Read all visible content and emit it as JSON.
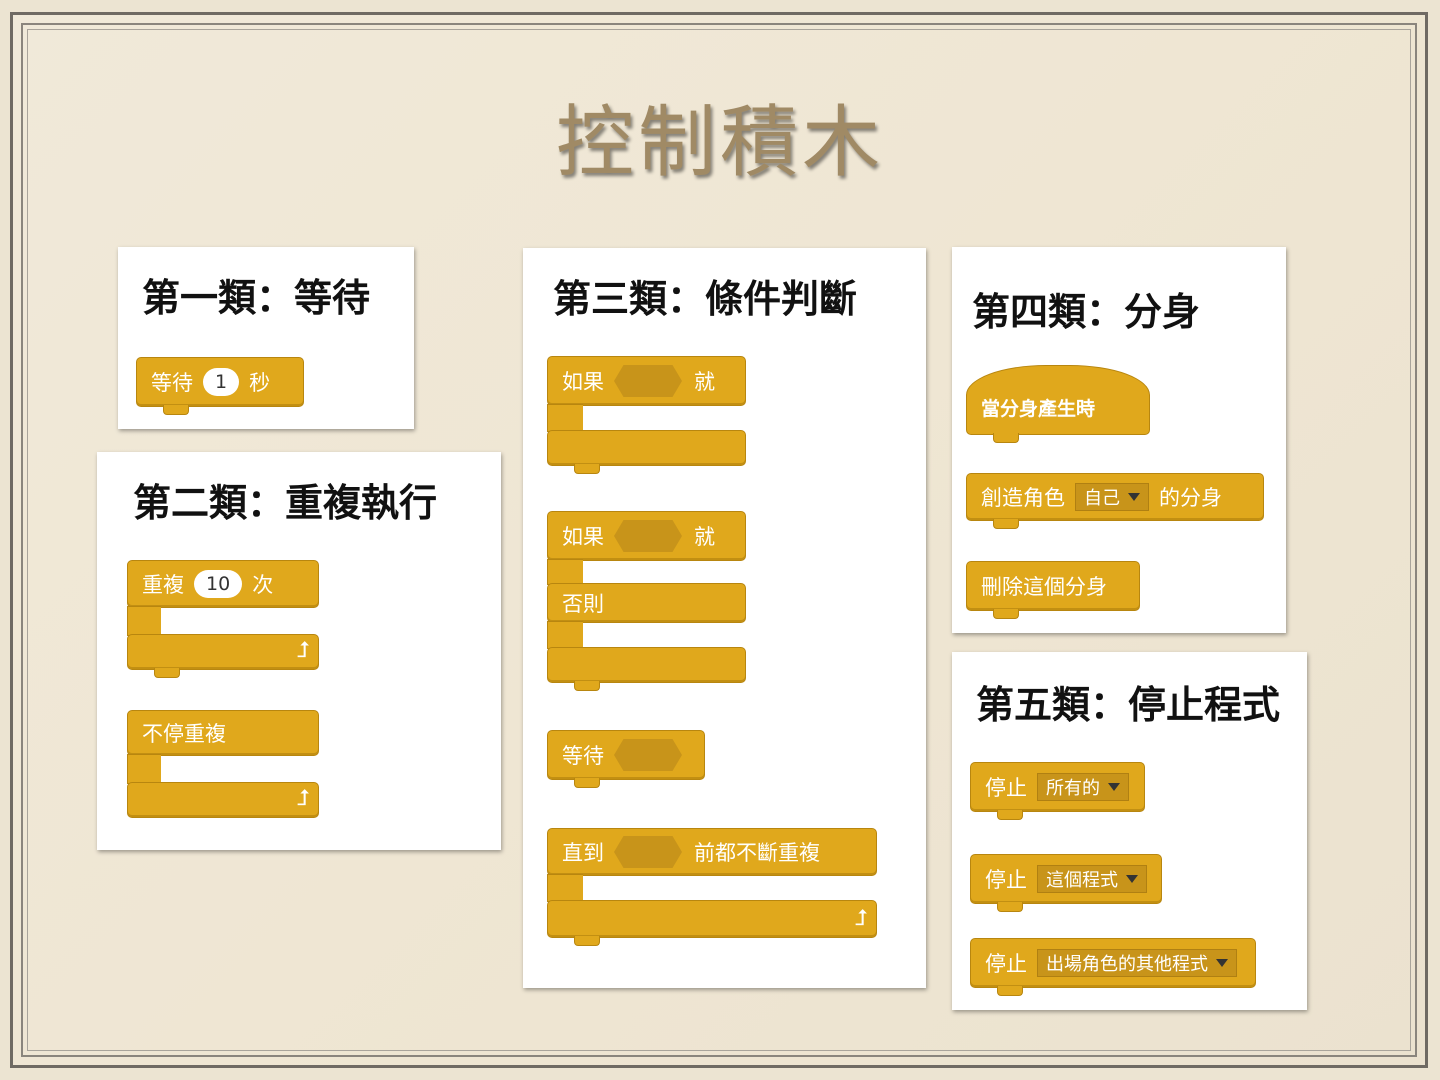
{
  "title": "控制積木",
  "panels": {
    "p1": {
      "title": "第一類：等待",
      "wait": {
        "label": "等待",
        "value": "1",
        "unit": "秒"
      }
    },
    "p2": {
      "title": "第二類：重複執行",
      "repeat": {
        "label": "重複",
        "value": "10",
        "unit": "次"
      },
      "forever": {
        "label": "不停重複"
      }
    },
    "p3": {
      "title": "第三類：條件判斷",
      "if1": {
        "label": "如果",
        "then": "就"
      },
      "if2": {
        "label": "如果",
        "then": "就",
        "else": "否則"
      },
      "waituntil": {
        "label": "等待"
      },
      "until": {
        "label": "直到",
        "suffix": "前都不斷重複"
      }
    },
    "p4": {
      "title": "第四類：分身",
      "hat": {
        "label": "當分身產生時"
      },
      "create": {
        "label": "創造角色",
        "option": "自己",
        "suffix": "的分身"
      },
      "delete": {
        "label": "刪除這個分身"
      }
    },
    "p5": {
      "title": "第五類：停止程式",
      "stop1": {
        "label": "停止",
        "option": "所有的"
      },
      "stop2": {
        "label": "停止",
        "option": "這個程式"
      },
      "stop3": {
        "label": "停止",
        "option": "出場角色的其他程式"
      }
    }
  },
  "colors": {
    "block": "#e0a81c",
    "title": "#a08a65"
  }
}
